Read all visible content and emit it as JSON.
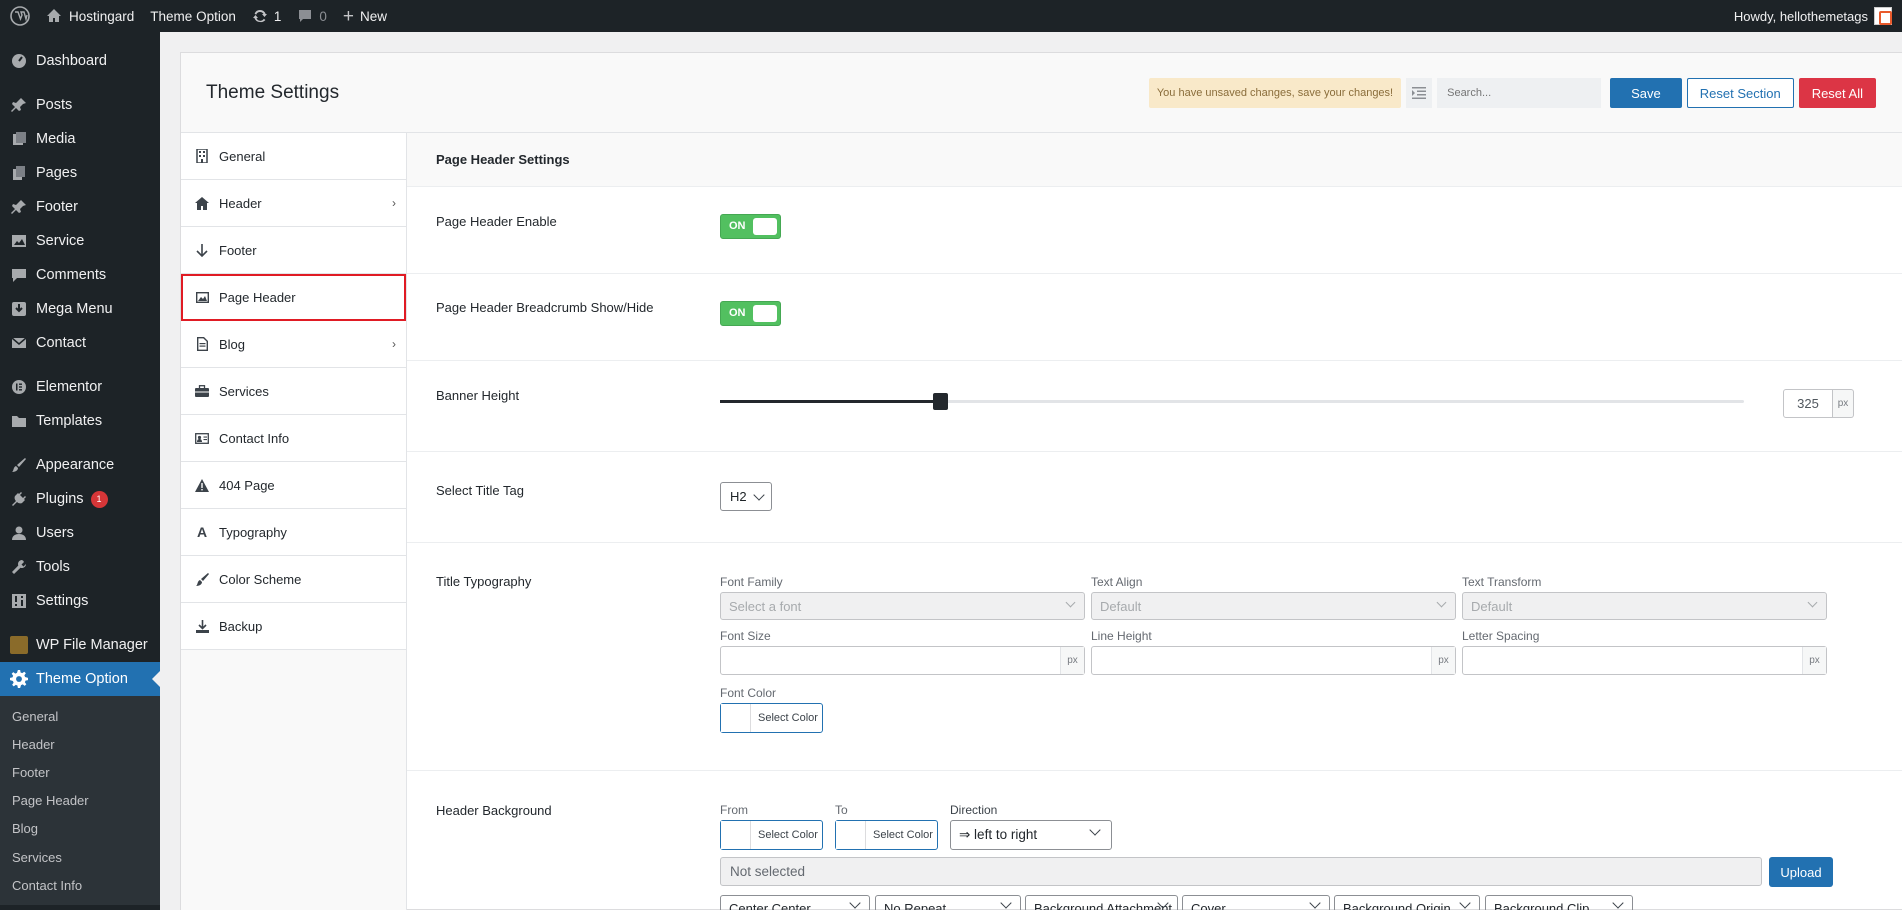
{
  "adminbar": {
    "site_name": "Hostingard",
    "theme_option": "Theme Option",
    "updates_count": "1",
    "comments_count": "0",
    "new_label": "New",
    "howdy": "Howdy, hellothemetags"
  },
  "menu": {
    "items": [
      {
        "label": "Dashboard",
        "icon": "dashboard-icon"
      },
      {
        "label": "Posts",
        "icon": "pin-icon"
      },
      {
        "label": "Media",
        "icon": "media-icon"
      },
      {
        "label": "Pages",
        "icon": "pages-icon"
      },
      {
        "label": "Footer",
        "icon": "pin-icon"
      },
      {
        "label": "Service",
        "icon": "image-icon"
      },
      {
        "label": "Comments",
        "icon": "comment-icon"
      },
      {
        "label": "Mega Menu",
        "icon": "download-icon"
      },
      {
        "label": "Contact",
        "icon": "mail-icon"
      },
      {
        "label": "Elementor",
        "icon": "elementor-icon"
      },
      {
        "label": "Templates",
        "icon": "folder-icon"
      },
      {
        "label": "Appearance",
        "icon": "brush-icon"
      },
      {
        "label": "Plugins",
        "icon": "plug-icon",
        "badge": "1"
      },
      {
        "label": "Users",
        "icon": "user-icon"
      },
      {
        "label": "Tools",
        "icon": "wrench-icon"
      },
      {
        "label": "Settings",
        "icon": "settings-icon"
      },
      {
        "label": "WP File Manager",
        "icon": "file-manager-icon"
      },
      {
        "label": "Theme Option",
        "icon": "gear-icon"
      }
    ],
    "submenu": [
      "General",
      "Header",
      "Footer",
      "Page Header",
      "Blog",
      "Services",
      "Contact Info"
    ]
  },
  "panel": {
    "title": "Theme Settings",
    "unsaved": "You have unsaved changes, save your changes!",
    "search_placeholder": "Search...",
    "save": "Save",
    "reset_section": "Reset Section",
    "reset_all": "Reset All"
  },
  "tabs": [
    {
      "label": "General",
      "icon": "building-icon"
    },
    {
      "label": "Header",
      "icon": "home-icon",
      "chevron": true
    },
    {
      "label": "Footer",
      "icon": "arrow-down-icon"
    },
    {
      "label": "Page Header",
      "icon": "image-icon"
    },
    {
      "label": "Blog",
      "icon": "document-icon",
      "chevron": true
    },
    {
      "label": "Services",
      "icon": "briefcase-icon"
    },
    {
      "label": "Contact Info",
      "icon": "contact-card-icon"
    },
    {
      "label": "404 Page",
      "icon": "warning-icon"
    },
    {
      "label": "Typography",
      "icon": "font-icon"
    },
    {
      "label": "Color Scheme",
      "icon": "paint-brush-icon"
    },
    {
      "label": "Backup",
      "icon": "backup-icon"
    }
  ],
  "content": {
    "section_title": "Page Header Settings",
    "enable_label": "Page Header Enable",
    "enable_value": "ON",
    "breadcrumb_label": "Page Header Breadcrumb Show/Hide",
    "breadcrumb_value": "ON",
    "banner_label": "Banner Height",
    "banner_value": "325",
    "banner_fraction": 0.215,
    "banner_unit": "px",
    "title_tag_label": "Select Title Tag",
    "title_tag_value": "H2",
    "title_typo_label": "Title Typography",
    "font_family_label": "Font Family",
    "font_family_placeholder": "Select a font",
    "text_align_label": "Text Align",
    "text_align_value": "Default",
    "text_transform_label": "Text Transform",
    "text_transform_value": "Default",
    "font_size_label": "Font Size",
    "line_height_label": "Line Height",
    "letter_spacing_label": "Letter Spacing",
    "unit_px": "px",
    "font_color_label": "Font Color",
    "select_color": "Select Color",
    "header_bg_label": "Header Background",
    "from_label": "From",
    "to_label": "To",
    "direction_label": "Direction",
    "direction_value": "⇒ left to right",
    "not_selected": "Not selected",
    "upload": "Upload",
    "bg_position": "Center Center",
    "bg_repeat": "No Repeat",
    "bg_attachment": "Background Attachment",
    "bg_size": "Cover",
    "bg_origin": "Background Origin",
    "bg_clip": "Background Clip"
  }
}
